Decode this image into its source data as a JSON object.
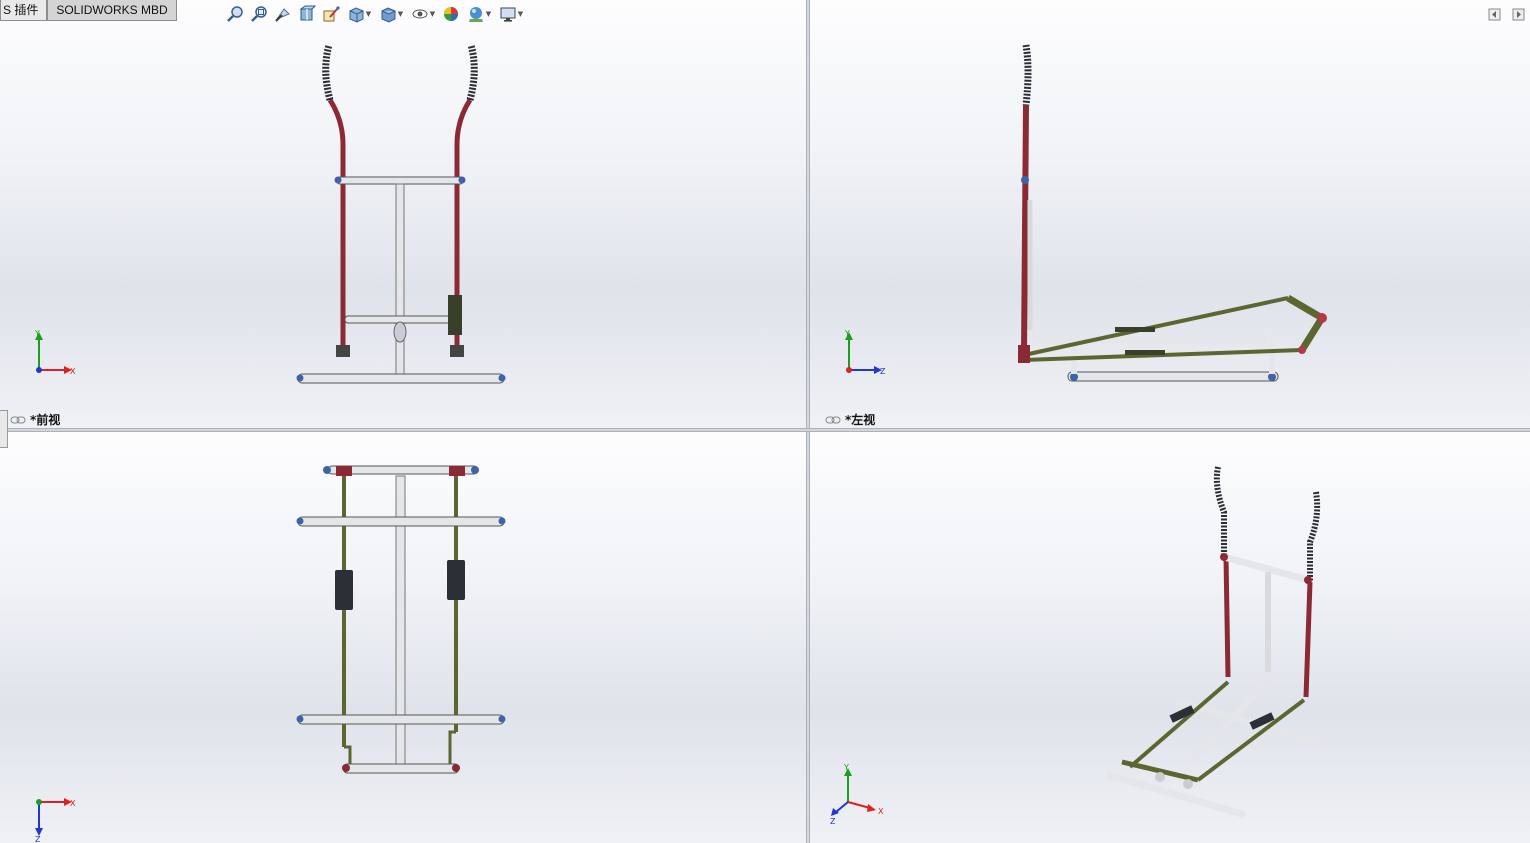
{
  "tabs": [
    {
      "label": "S 插件"
    },
    {
      "label": "SOLIDWORKS MBD"
    }
  ],
  "heads_up_toolbar": {
    "icons": [
      "zoom-to-fit-icon",
      "zoom-to-area-icon",
      "previous-view-icon",
      "section-view-icon",
      "dynamic-annotation-icon",
      "view-orientation-icon",
      "display-style-icon",
      "hide-show-items-icon",
      "edit-appearance-icon",
      "apply-scene-icon",
      "view-settings-icon"
    ]
  },
  "viewports": {
    "front": {
      "label": "*前视"
    },
    "left": {
      "label": "*左视"
    },
    "top": {
      "label": ""
    },
    "isometric": {
      "label": ""
    }
  },
  "triad": {
    "x": "X",
    "y": "Y",
    "z": "Z"
  },
  "colors": {
    "frame_red": "#8b2a35",
    "frame_olive": "#5c6631",
    "tube_white": "#e4e6ea",
    "joint_blue": "#3e63a8",
    "grip_dark": "#2b2f36",
    "axis_x": "#e02020",
    "axis_y": "#1aa01a",
    "axis_z": "#2038d0"
  }
}
